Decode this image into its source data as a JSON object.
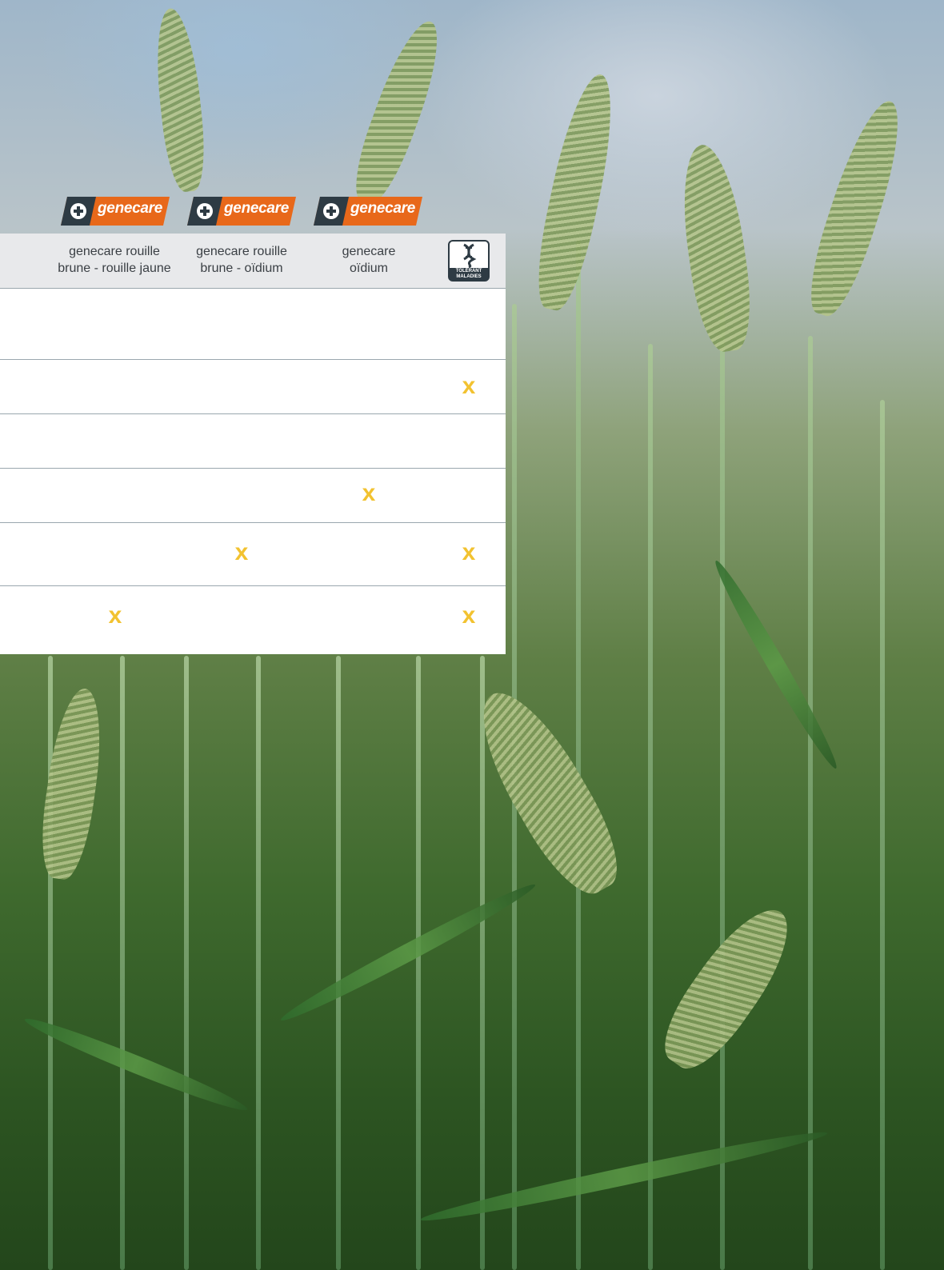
{
  "brand": {
    "logos": [
      {
        "name": "genecare",
        "subtitle": "ROUILLE BRUNE - ROUILLE JAUNE"
      },
      {
        "name": "genecare",
        "subtitle": "ROUILLE BRUNE - OÏDIUM"
      },
      {
        "name": "genecare",
        "subtitle": "OÏDIUM"
      }
    ],
    "colors": {
      "orange": "#e8681a",
      "dark": "#2e3b44",
      "mark": "#f2c230"
    }
  },
  "table": {
    "columns": [
      {
        "line1": "genecare rouille",
        "line2": "brune - rouille jaune"
      },
      {
        "line1": "genecare rouille",
        "line2": "brune - oïdium"
      },
      {
        "line1": "genecare",
        "line2": "oïdium"
      }
    ],
    "badge": {
      "icon": "dna-icon",
      "label_line1": "TOLÉRANT",
      "label_line2": "MALADIES"
    },
    "rows": [
      {
        "marks": [
          "",
          "",
          "",
          ""
        ]
      },
      {
        "marks": [
          "",
          "",
          "",
          "x"
        ]
      },
      {
        "marks": [
          "",
          "",
          "",
          ""
        ]
      },
      {
        "marks": [
          "",
          "",
          "x",
          ""
        ]
      },
      {
        "marks": [
          "",
          "x",
          "",
          "x"
        ]
      },
      {
        "marks": [
          "x",
          "",
          "",
          "x"
        ]
      }
    ]
  }
}
